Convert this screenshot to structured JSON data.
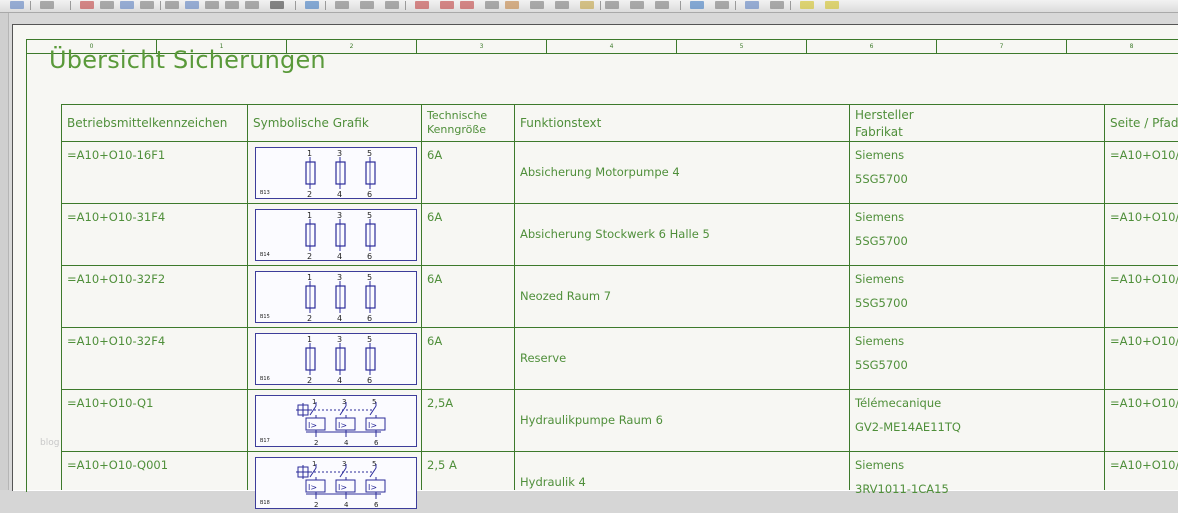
{
  "ruler": [
    "0",
    "1",
    "2",
    "3",
    "4",
    "5",
    "6",
    "7",
    "8"
  ],
  "title": "Übersicht Sicherungen",
  "watermark": "blog",
  "headers": {
    "col1": "Betriebsmittelkennzeichen",
    "col2": "Symbolische Grafik",
    "col3_line1": "Technische",
    "col3_line2": "Kenngröße",
    "col4": "Funktionstext",
    "col5_line1": "Hersteller",
    "col5_line2": "Fabrikat",
    "col6": "Seite / Pfad"
  },
  "rows": [
    {
      "bmk": "=A10+O10-16F1",
      "size": "6A",
      "func": "Absicherung Motorpumpe 4",
      "maker": "Siemens",
      "model": "5SG5700",
      "page": "=A10+O10/",
      "sym_label": "B13",
      "sym_type": "fuse"
    },
    {
      "bmk": "=A10+O10-31F4",
      "size": "6A",
      "func": "Absicherung Stockwerk 6 Halle 5",
      "maker": "Siemens",
      "model": "5SG5700",
      "page": "=A10+O10/",
      "sym_label": "B14",
      "sym_type": "fuse"
    },
    {
      "bmk": "=A10+O10-32F2",
      "size": "6A",
      "func": "Neozed Raum 7",
      "maker": "Siemens",
      "model": "5SG5700",
      "page": "=A10+O10/",
      "sym_label": "B15",
      "sym_type": "fuse"
    },
    {
      "bmk": "=A10+O10-32F4",
      "size": "6A",
      "func": "Reserve",
      "maker": "Siemens",
      "model": "5SG5700",
      "page": "=A10+O10/",
      "sym_label": "B16",
      "sym_type": "fuse"
    },
    {
      "bmk": "=A10+O10-Q1",
      "size": "2,5A",
      "func": "Hydraulikpumpe Raum 6",
      "maker": "Télémecanique",
      "model": "GV2-ME14AE11TQ",
      "page": "=A10+O10/",
      "sym_label": "B17",
      "sym_type": "breaker"
    },
    {
      "bmk": "=A10+O10-Q001",
      "size": "2,5 A",
      "func": "Hydraulik 4",
      "maker": "Siemens",
      "model": "3RV1011-1CA15",
      "page": "=A10+O10/",
      "sym_label": "B18",
      "sym_type": "breaker"
    }
  ],
  "terminals": {
    "top": [
      "1",
      "3",
      "5"
    ],
    "bottom": [
      "2",
      "4",
      "6"
    ]
  },
  "breaker_text": "I>",
  "colors": {
    "line": "#3d7a2b",
    "text": "#4f8f3a",
    "title": "#5a9a3a",
    "symbol": "#2b2b9a"
  }
}
